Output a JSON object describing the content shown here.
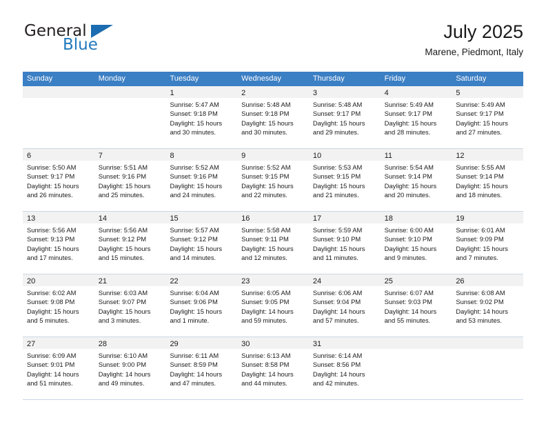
{
  "brand": {
    "name_part1": "General",
    "name_part2": "Blue",
    "triangle_color": "#1b6cb0",
    "blue_color": "#2279bd"
  },
  "header": {
    "title": "July 2025",
    "subtitle": "Marene, Piedmont, Italy"
  },
  "theme": {
    "header_row_bg": "#3b7fc4",
    "daynum_bg": "#f2f2f2",
    "grid_line": "#c9d7e5"
  },
  "weekdays": [
    "Sunday",
    "Monday",
    "Tuesday",
    "Wednesday",
    "Thursday",
    "Friday",
    "Saturday"
  ],
  "weeks": [
    [
      {
        "day": "",
        "empty": true,
        "lines": []
      },
      {
        "day": "",
        "empty": true,
        "lines": []
      },
      {
        "day": "1",
        "lines": [
          "Sunrise: 5:47 AM",
          "Sunset: 9:18 PM",
          "Daylight: 15 hours",
          "and 30 minutes."
        ]
      },
      {
        "day": "2",
        "lines": [
          "Sunrise: 5:48 AM",
          "Sunset: 9:18 PM",
          "Daylight: 15 hours",
          "and 30 minutes."
        ]
      },
      {
        "day": "3",
        "lines": [
          "Sunrise: 5:48 AM",
          "Sunset: 9:17 PM",
          "Daylight: 15 hours",
          "and 29 minutes."
        ]
      },
      {
        "day": "4",
        "lines": [
          "Sunrise: 5:49 AM",
          "Sunset: 9:17 PM",
          "Daylight: 15 hours",
          "and 28 minutes."
        ]
      },
      {
        "day": "5",
        "lines": [
          "Sunrise: 5:49 AM",
          "Sunset: 9:17 PM",
          "Daylight: 15 hours",
          "and 27 minutes."
        ]
      }
    ],
    [
      {
        "day": "6",
        "lines": [
          "Sunrise: 5:50 AM",
          "Sunset: 9:17 PM",
          "Daylight: 15 hours",
          "and 26 minutes."
        ]
      },
      {
        "day": "7",
        "lines": [
          "Sunrise: 5:51 AM",
          "Sunset: 9:16 PM",
          "Daylight: 15 hours",
          "and 25 minutes."
        ]
      },
      {
        "day": "8",
        "lines": [
          "Sunrise: 5:52 AM",
          "Sunset: 9:16 PM",
          "Daylight: 15 hours",
          "and 24 minutes."
        ]
      },
      {
        "day": "9",
        "lines": [
          "Sunrise: 5:52 AM",
          "Sunset: 9:15 PM",
          "Daylight: 15 hours",
          "and 22 minutes."
        ]
      },
      {
        "day": "10",
        "lines": [
          "Sunrise: 5:53 AM",
          "Sunset: 9:15 PM",
          "Daylight: 15 hours",
          "and 21 minutes."
        ]
      },
      {
        "day": "11",
        "lines": [
          "Sunrise: 5:54 AM",
          "Sunset: 9:14 PM",
          "Daylight: 15 hours",
          "and 20 minutes."
        ]
      },
      {
        "day": "12",
        "lines": [
          "Sunrise: 5:55 AM",
          "Sunset: 9:14 PM",
          "Daylight: 15 hours",
          "and 18 minutes."
        ]
      }
    ],
    [
      {
        "day": "13",
        "lines": [
          "Sunrise: 5:56 AM",
          "Sunset: 9:13 PM",
          "Daylight: 15 hours",
          "and 17 minutes."
        ]
      },
      {
        "day": "14",
        "lines": [
          "Sunrise: 5:56 AM",
          "Sunset: 9:12 PM",
          "Daylight: 15 hours",
          "and 15 minutes."
        ]
      },
      {
        "day": "15",
        "lines": [
          "Sunrise: 5:57 AM",
          "Sunset: 9:12 PM",
          "Daylight: 15 hours",
          "and 14 minutes."
        ]
      },
      {
        "day": "16",
        "lines": [
          "Sunrise: 5:58 AM",
          "Sunset: 9:11 PM",
          "Daylight: 15 hours",
          "and 12 minutes."
        ]
      },
      {
        "day": "17",
        "lines": [
          "Sunrise: 5:59 AM",
          "Sunset: 9:10 PM",
          "Daylight: 15 hours",
          "and 11 minutes."
        ]
      },
      {
        "day": "18",
        "lines": [
          "Sunrise: 6:00 AM",
          "Sunset: 9:10 PM",
          "Daylight: 15 hours",
          "and 9 minutes."
        ]
      },
      {
        "day": "19",
        "lines": [
          "Sunrise: 6:01 AM",
          "Sunset: 9:09 PM",
          "Daylight: 15 hours",
          "and 7 minutes."
        ]
      }
    ],
    [
      {
        "day": "20",
        "lines": [
          "Sunrise: 6:02 AM",
          "Sunset: 9:08 PM",
          "Daylight: 15 hours",
          "and 5 minutes."
        ]
      },
      {
        "day": "21",
        "lines": [
          "Sunrise: 6:03 AM",
          "Sunset: 9:07 PM",
          "Daylight: 15 hours",
          "and 3 minutes."
        ]
      },
      {
        "day": "22",
        "lines": [
          "Sunrise: 6:04 AM",
          "Sunset: 9:06 PM",
          "Daylight: 15 hours",
          "and 1 minute."
        ]
      },
      {
        "day": "23",
        "lines": [
          "Sunrise: 6:05 AM",
          "Sunset: 9:05 PM",
          "Daylight: 14 hours",
          "and 59 minutes."
        ]
      },
      {
        "day": "24",
        "lines": [
          "Sunrise: 6:06 AM",
          "Sunset: 9:04 PM",
          "Daylight: 14 hours",
          "and 57 minutes."
        ]
      },
      {
        "day": "25",
        "lines": [
          "Sunrise: 6:07 AM",
          "Sunset: 9:03 PM",
          "Daylight: 14 hours",
          "and 55 minutes."
        ]
      },
      {
        "day": "26",
        "lines": [
          "Sunrise: 6:08 AM",
          "Sunset: 9:02 PM",
          "Daylight: 14 hours",
          "and 53 minutes."
        ]
      }
    ],
    [
      {
        "day": "27",
        "lines": [
          "Sunrise: 6:09 AM",
          "Sunset: 9:01 PM",
          "Daylight: 14 hours",
          "and 51 minutes."
        ]
      },
      {
        "day": "28",
        "lines": [
          "Sunrise: 6:10 AM",
          "Sunset: 9:00 PM",
          "Daylight: 14 hours",
          "and 49 minutes."
        ]
      },
      {
        "day": "29",
        "lines": [
          "Sunrise: 6:11 AM",
          "Sunset: 8:59 PM",
          "Daylight: 14 hours",
          "and 47 minutes."
        ]
      },
      {
        "day": "30",
        "lines": [
          "Sunrise: 6:13 AM",
          "Sunset: 8:58 PM",
          "Daylight: 14 hours",
          "and 44 minutes."
        ]
      },
      {
        "day": "31",
        "lines": [
          "Sunrise: 6:14 AM",
          "Sunset: 8:56 PM",
          "Daylight: 14 hours",
          "and 42 minutes."
        ]
      },
      {
        "day": "",
        "empty": true,
        "lines": []
      },
      {
        "day": "",
        "empty": true,
        "lines": []
      }
    ]
  ]
}
